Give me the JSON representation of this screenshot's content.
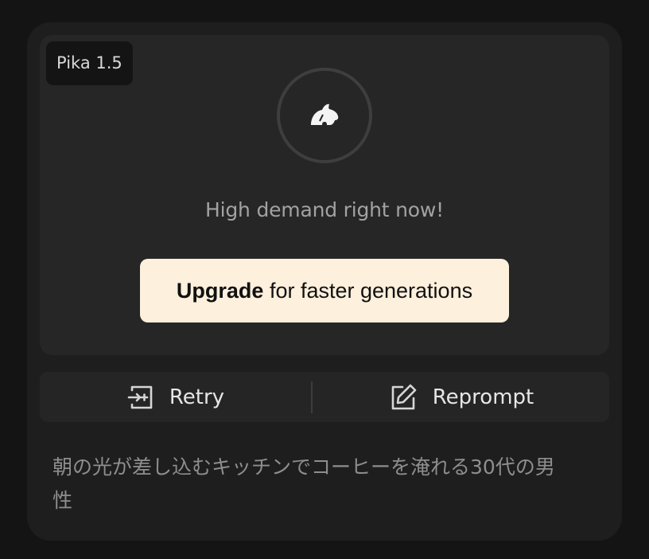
{
  "card": {
    "model_badge": "Pika 1.5",
    "loader_icon": "bunny-logo-icon",
    "status_text": "High demand right now!",
    "upgrade": {
      "bold_label": "Upgrade",
      "rest_label": " for faster generations"
    },
    "actions": {
      "retry": {
        "icon": "retry-icon",
        "label": "Retry"
      },
      "reprompt": {
        "icon": "edit-icon",
        "label": "Reprompt"
      }
    },
    "prompt_text": "朝の光が差し込むキッチンでコーヒーを淹れる30代の男性"
  },
  "colors": {
    "page_background": "#141414",
    "card_background": "#1e1e1e",
    "preview_background": "#262626",
    "upgrade_background": "#fdf0dc",
    "status_text": "#a2a2a2",
    "prompt_text": "#8e8e8e"
  }
}
